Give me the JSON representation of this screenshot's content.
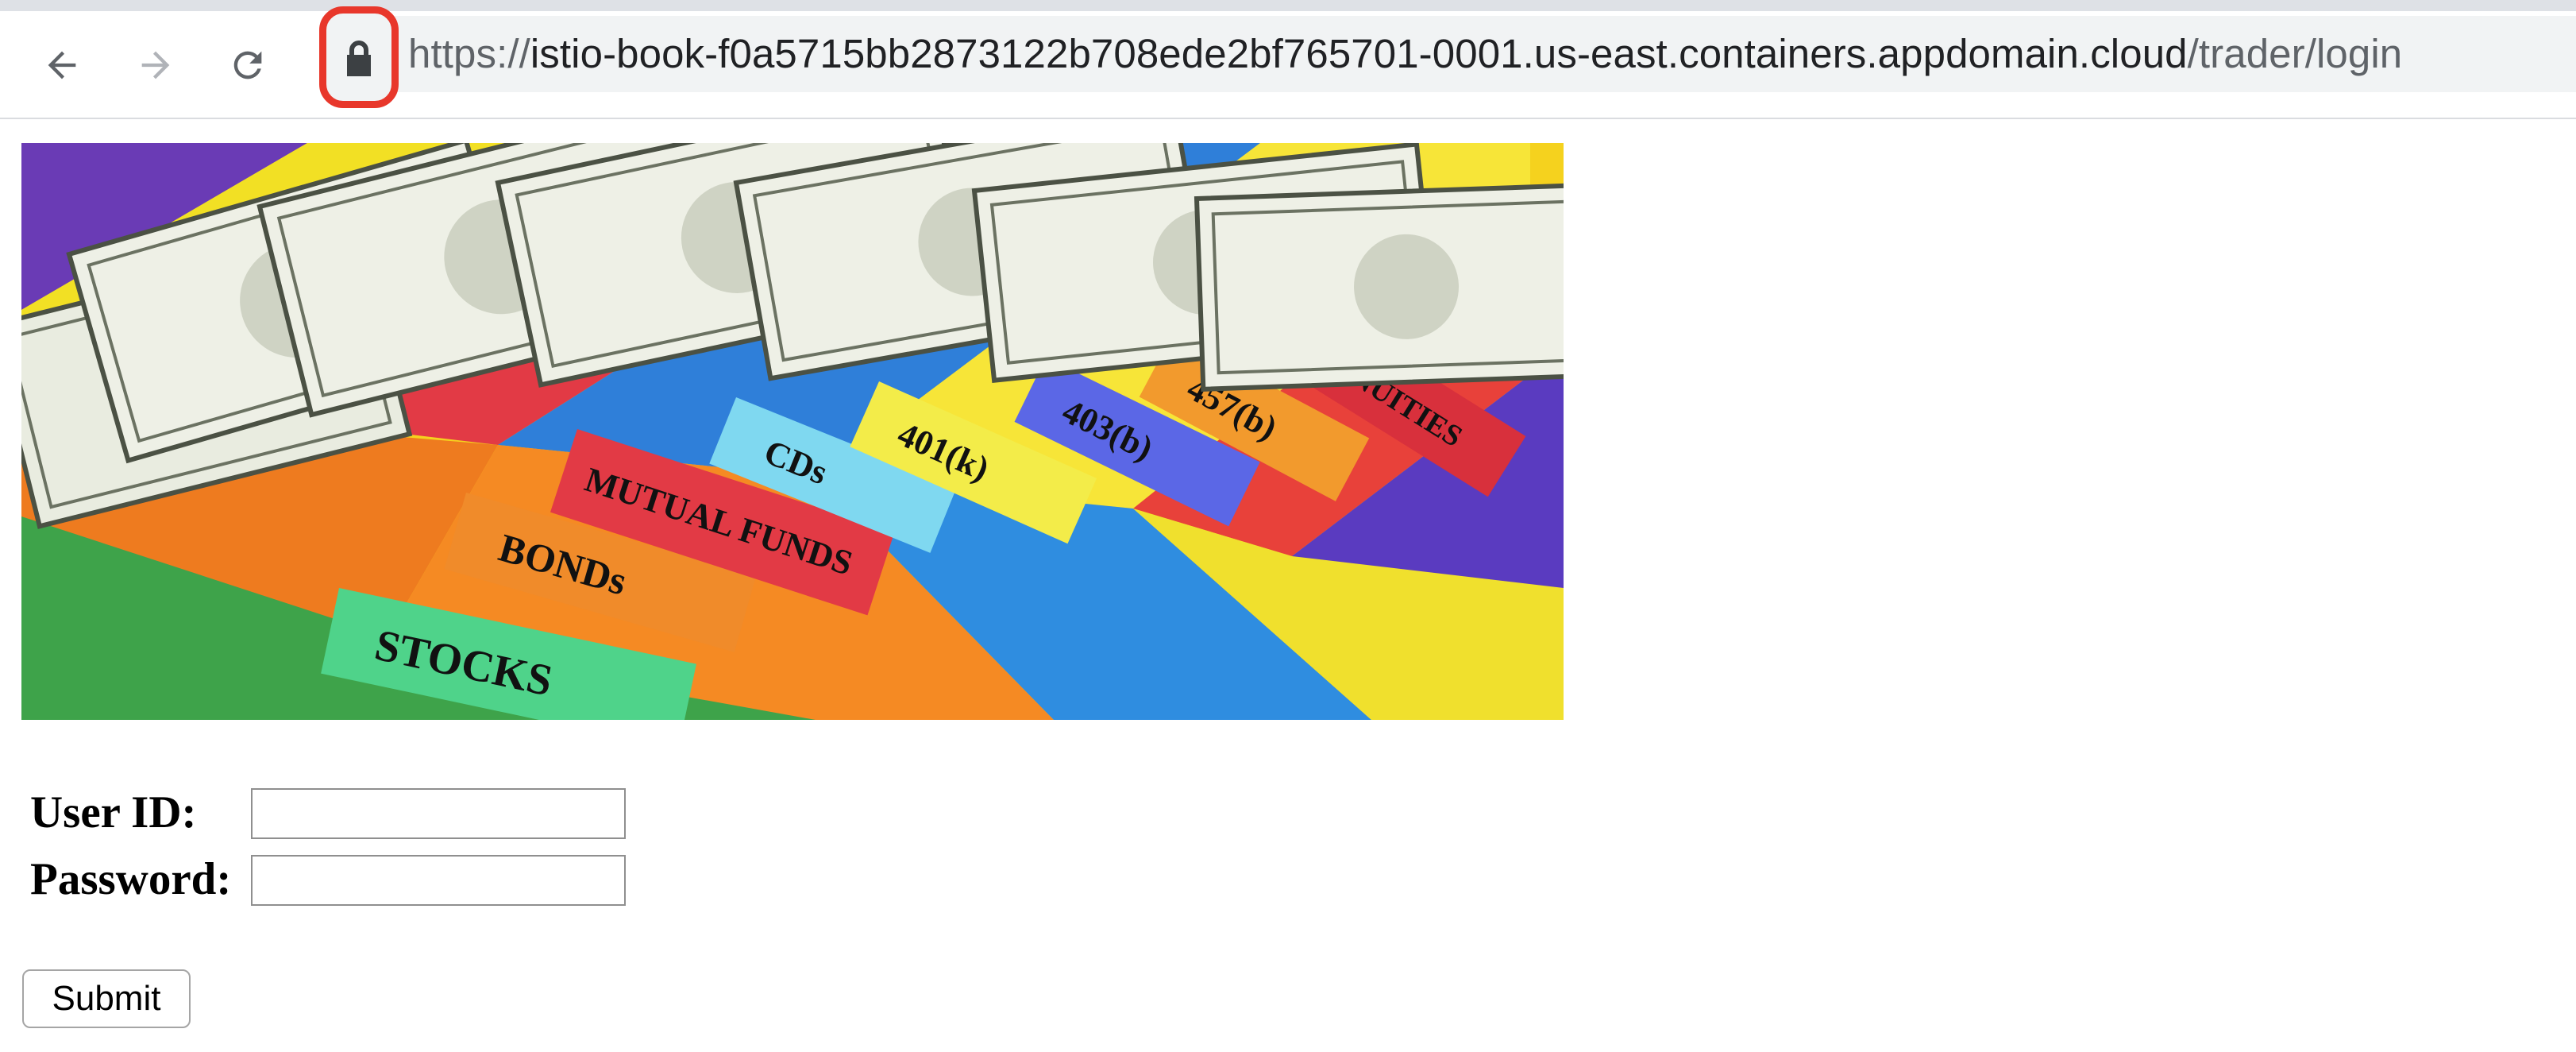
{
  "browser": {
    "url_scheme": "https://",
    "url_host": "istio-book-f0a5715bb2873122b708ede2bf765701-0001.us-east.containers.appdomain.cloud",
    "url_path": "/trader/login",
    "icons": {
      "back": "back-arrow-icon",
      "forward": "forward-arrow-icon",
      "reload": "reload-icon",
      "lock": "lock-icon"
    },
    "lock_highlight_color": "#e8372b"
  },
  "banner": {
    "tabs": [
      "STOCKS",
      "BONDs",
      "MUTUAL FUNDS",
      "CDs",
      "401(k)",
      "403(b)",
      "457(b)",
      "ANNUITIES"
    ]
  },
  "form": {
    "user_id_label": "User ID:",
    "user_id_value": "",
    "password_label": "Password:",
    "password_value": "",
    "submit_label": "Submit"
  }
}
